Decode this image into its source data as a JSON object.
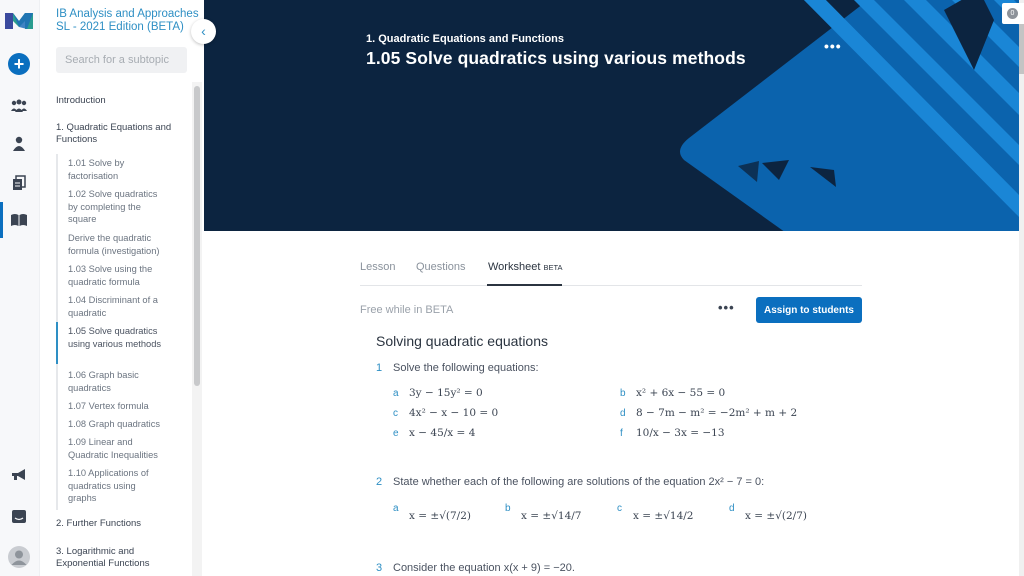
{
  "rail": {
    "icons": [
      "logo-icon",
      "add-icon",
      "classes-icon",
      "profile-icon",
      "documents-icon",
      "book-icon",
      "announcement-icon",
      "chat-icon",
      "avatar-icon"
    ]
  },
  "sidebar": {
    "course_title": "IB Analysis and Approaches SL - 2021 Edition (BETA)",
    "search_placeholder": "Search for a subtopic",
    "introduction": "Introduction",
    "chapter1": "1. Quadratic Equations and Functions",
    "subtopics": [
      "1.01 Solve by factorisation",
      "1.02 Solve quadratics by completing the square",
      "Derive the quadratic formula (investigation)",
      "1.03 Solve using the quadratic formula",
      "1.04 Discriminant of a quadratic",
      "1.05 Solve quadratics using various methods",
      "1.06 Graph basic quadratics",
      "1.07 Vertex formula",
      "1.08 Graph quadratics",
      "1.09 Linear and Quadratic Inequalities",
      "1.10 Applications of quadratics using graphs"
    ],
    "active_subtopic_index": 5,
    "chapter2": "2. Further Functions",
    "chapter3": "3. Logarithmic and Exponential Functions"
  },
  "header": {
    "breadcrumb": "1. Quadratic Equations and Functions",
    "title": "1.05 Solve quadratics using various methods",
    "more": "•••",
    "notification_count": "0",
    "colors": {
      "dark": "#0c2440",
      "blue": "#0b6fbf",
      "light_blue": "#1a86d6"
    }
  },
  "tabs": [
    {
      "label": "Lesson",
      "active": false
    },
    {
      "label": "Questions",
      "active": false
    },
    {
      "label": "Worksheet",
      "badge": "BETA",
      "active": true
    }
  ],
  "toolbar": {
    "free_text": "Free while in BETA",
    "more": "•••",
    "assign_label": "Assign to students"
  },
  "worksheet": {
    "title": "Solving quadratic equations",
    "q1": {
      "num": "1",
      "text": "Solve the following equations:",
      "parts": {
        "a": "3y − 15y² = 0",
        "b": "x² + 6x − 55 = 0",
        "c": "4x² − x − 10 = 0",
        "d": "8 − 7m − m² = −2m² + m + 2",
        "e": "x − 45/x = 4",
        "f": "10/x − 3x = −13"
      }
    },
    "q2": {
      "num": "2",
      "text": "State whether each of the following are solutions of the equation 2x² − 7 = 0:",
      "parts": {
        "a": "x = ±√(7/2)",
        "b": "x = ±√14/7",
        "c": "x = ±√14/2",
        "d": "x = ±√(2/7)"
      }
    },
    "q3": {
      "num": "3",
      "text": "Consider the equation x(x + 9) = −20."
    }
  }
}
